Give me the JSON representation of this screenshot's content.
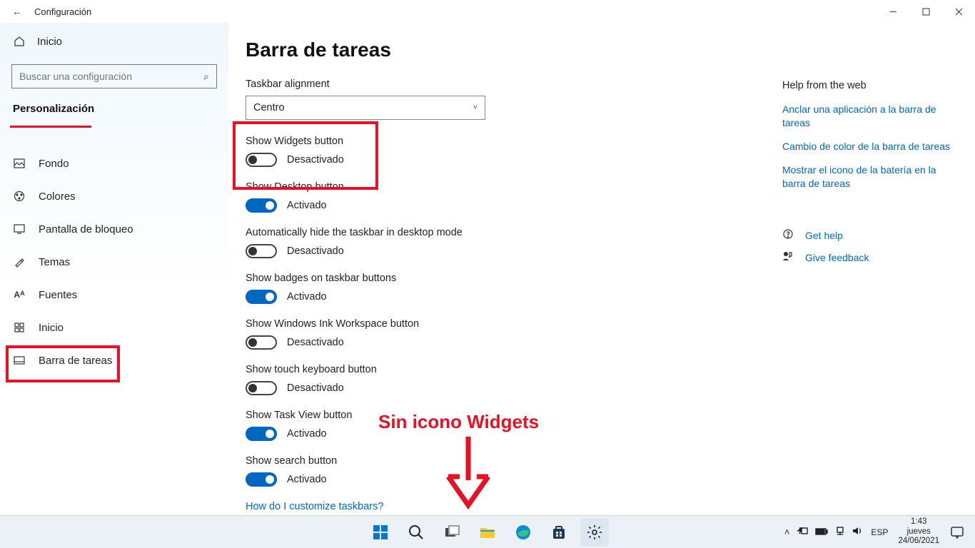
{
  "titlebar": {
    "title": "Configuración"
  },
  "sidebar": {
    "home": "Inicio",
    "search_placeholder": "Buscar una configuración",
    "category": "Personalización",
    "items": [
      {
        "label": "Fondo",
        "icon": "picture"
      },
      {
        "label": "Colores",
        "icon": "palette"
      },
      {
        "label": "Pantalla de bloqueo",
        "icon": "lock-screen"
      },
      {
        "label": "Temas",
        "icon": "themes"
      },
      {
        "label": "Fuentes",
        "icon": "fonts"
      },
      {
        "label": "Inicio",
        "icon": "start"
      },
      {
        "label": "Barra de tareas",
        "icon": "taskbar"
      }
    ]
  },
  "page": {
    "title": "Barra de tareas",
    "alignment_label": "Taskbar alignment",
    "alignment_value": "Centro",
    "settings": [
      {
        "label": "Show Widgets button",
        "state": "Desactivado",
        "on": false
      },
      {
        "label": "Show Desktop button",
        "state": "Activado",
        "on": true
      },
      {
        "label": "Automatically hide the taskbar in desktop mode",
        "state": "Desactivado",
        "on": false
      },
      {
        "label": "Show badges on taskbar buttons",
        "state": "Activado",
        "on": true
      },
      {
        "label": "Show Windows Ink Workspace button",
        "state": "Desactivado",
        "on": false
      },
      {
        "label": "Show touch keyboard button",
        "state": "Desactivado",
        "on": false
      },
      {
        "label": "Show Task View button",
        "state": "Activado",
        "on": true
      },
      {
        "label": "Show search button",
        "state": "Activado",
        "on": true
      }
    ],
    "bottom_link": "How do I customize taskbars?"
  },
  "help": {
    "title": "Help from the web",
    "links": [
      "Anclar una aplicación a la barra de tareas",
      "Cambio de color de la barra de tareas",
      "Mostrar el icono de la batería en la barra de tareas"
    ],
    "get_help": "Get help",
    "feedback": "Give feedback"
  },
  "annotation": {
    "text": "Sin icono Widgets"
  },
  "taskbar": {
    "lang": "ESP",
    "time": "1:43",
    "day": "jueves",
    "date": "24/06/2021"
  }
}
